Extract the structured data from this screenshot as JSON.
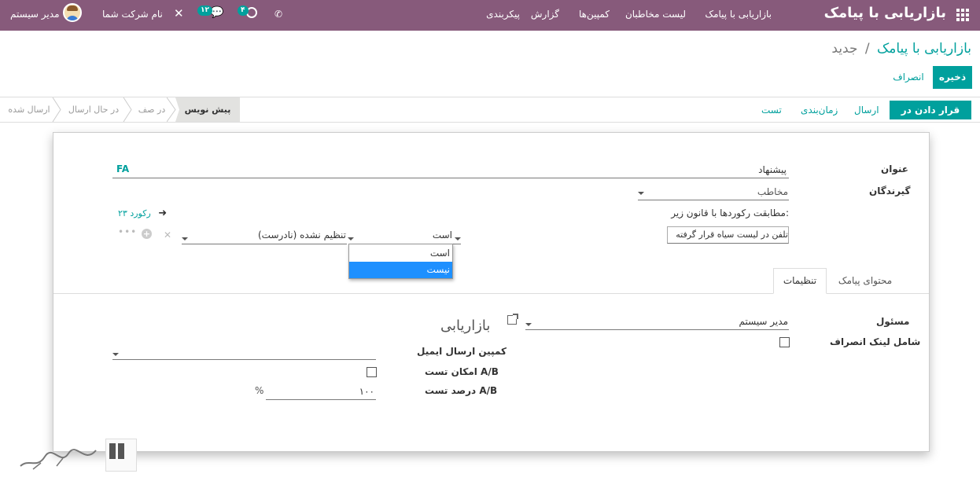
{
  "navbar": {
    "app_title": "بازاریابی با پیامک",
    "menus": [
      "بازاریابی با پیامک",
      "لیست مخاطبان",
      "کمپین‌ها",
      "گزارش",
      "پیکربندی"
    ],
    "user_name": "مدیر سیستم",
    "company_name": "نام شرکت شما",
    "messages_count": "۱۲",
    "activities_count": "۴"
  },
  "breadcrumb": {
    "parent": "بازاریابی با پیامک",
    "separator": "/",
    "current": "جدید"
  },
  "buttons": {
    "save": "ذخیره",
    "discard": "انصراف",
    "queue": "قرار دادن در صف",
    "send": "ارسال",
    "schedule": "زمان‌بندی",
    "test": "تست"
  },
  "statusbar": [
    "پیش نویس",
    "در صف",
    "در حال ارسال",
    "ارسال شده"
  ],
  "form": {
    "subject_label": "عنوان",
    "subject_value": "پیشنهاد",
    "lang_code": "FA",
    "recipients_label": "گیرندگان",
    "recipients_value": "مخاطب",
    "match_rule": "مطابقت رکوردها با قانون زیر:",
    "record_count": "۲۳ رکورد",
    "domain_field": "تلفن در لیست سیاه قرار گرفته",
    "domain_operator": "است",
    "domain_value": "تنظیم نشده (نادرست)",
    "dropdown_options": [
      "است",
      "نیست"
    ]
  },
  "tabs": [
    "محتوای پیامک",
    "تنظیمات"
  ],
  "settings": {
    "responsible_label": "مسئول",
    "responsible_value": "مدیر سیستم",
    "unsubscribe_label": "شامل لینک انصراف",
    "section_title": "بازاریابی",
    "campaign_label": "کمپین ارسال ایمیل",
    "ab_label": "امکان تست A/B",
    "ab_percent_label": "درصد تست A/B",
    "ab_percent_value": "۱۰۰",
    "percent_sign": "%"
  },
  "colors": {
    "navbar": "#875a7b",
    "accent": "#00a09d",
    "selected_option": "#1e90ff"
  }
}
